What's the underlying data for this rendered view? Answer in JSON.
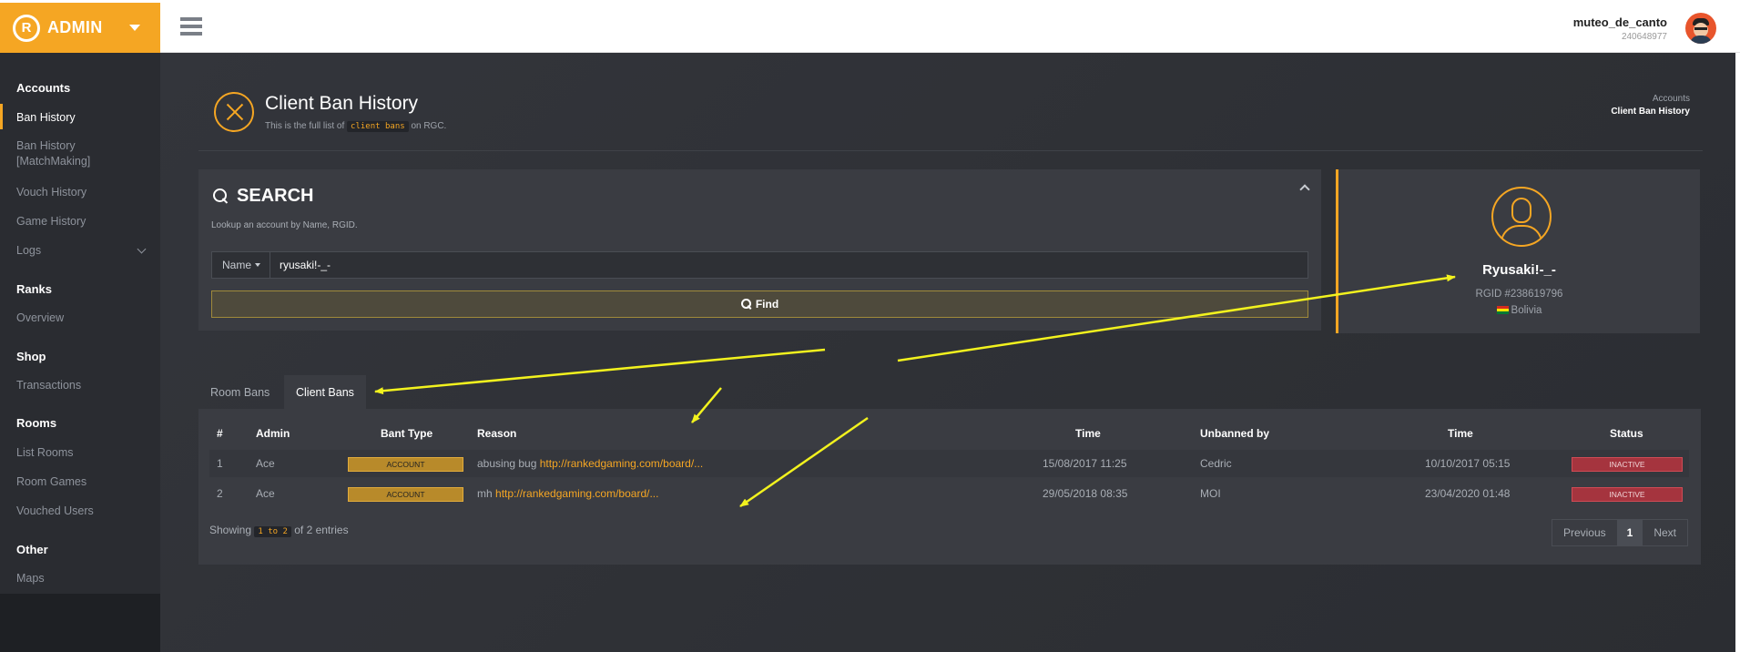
{
  "brand": {
    "label": "ADMIN",
    "logo_glyph": "R"
  },
  "sidebar": {
    "sections": [
      {
        "title": "Accounts",
        "items": [
          "Ban History",
          "Ban History [MatchMaking]",
          "Vouch History",
          "Game History",
          "Logs"
        ]
      },
      {
        "title": "Ranks",
        "items": [
          "Overview"
        ]
      },
      {
        "title": "Shop",
        "items": [
          "Transactions"
        ]
      },
      {
        "title": "Rooms",
        "items": [
          "List Rooms",
          "Room Games",
          "Vouched Users"
        ]
      },
      {
        "title": "Other",
        "items": [
          "Maps"
        ]
      }
    ],
    "active_item": "Ban History"
  },
  "header": {
    "username": "muteo_de_canto",
    "user_id": "240648977"
  },
  "page": {
    "title": "Client Ban History",
    "subtitle_before": "This is the full list of",
    "subtitle_code": "client bans",
    "subtitle_after": "on RGC.",
    "breadcrumb": [
      "Accounts",
      "Client Ban History"
    ]
  },
  "search": {
    "title": "SEARCH",
    "description": "Lookup an account by Name, RGID.",
    "select_value": "Name",
    "input_value": "ryusaki!-_-",
    "find_label": "Find"
  },
  "profile": {
    "name": "Ryusaki!-_-",
    "rgid": "RGID #238619796",
    "country": "Bolivia"
  },
  "tabs": {
    "room": "Room Bans",
    "client": "Client Bans",
    "active": "Client Bans"
  },
  "table": {
    "headers": [
      "#",
      "Admin",
      "Bant Type",
      "Reason",
      "Time",
      "Unbanned by",
      "Time",
      "Status"
    ],
    "rows": [
      {
        "num": "1",
        "admin": "Ace",
        "type": "ACCOUNT",
        "reason_text": "abusing bug",
        "reason_link": "http://rankedgaming.com/board/...",
        "time": "15/08/2017 11:25",
        "unbanned_by": "Cedric",
        "time2": "10/10/2017 05:15",
        "status": "INACTIVE"
      },
      {
        "num": "2",
        "admin": "Ace",
        "type": "ACCOUNT",
        "reason_text": "mh",
        "reason_link": "http://rankedgaming.com/board/...",
        "time": "29/05/2018 08:35",
        "unbanned_by": "MOI",
        "time2": "23/04/2020 01:48",
        "status": "INACTIVE"
      }
    ],
    "showing_before": "Showing",
    "showing_range": "1 to 2",
    "showing_after": "of 2 entries",
    "pager": {
      "prev": "Previous",
      "current": "1",
      "next": "Next"
    }
  },
  "colors": {
    "accent": "#f5a623",
    "sidebar": "#2a2c31",
    "panel": "#3a3c42",
    "inactive": "#a5343e",
    "annotation": "#f2f21e"
  }
}
